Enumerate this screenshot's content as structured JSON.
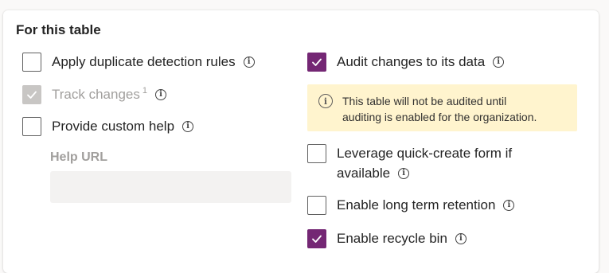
{
  "section": {
    "title": "For this table"
  },
  "left": {
    "duplicate_detection": {
      "label": "Apply duplicate detection rules",
      "checked": false
    },
    "track_changes": {
      "label": "Track changes",
      "superscript": "1",
      "checked": true,
      "disabled": true
    },
    "custom_help": {
      "label": "Provide custom help",
      "checked": false
    },
    "help_url": {
      "label": "Help URL",
      "value": ""
    }
  },
  "right": {
    "audit_changes": {
      "label": "Audit changes to its data",
      "checked": true
    },
    "audit_notice": {
      "text": "This table will not be audited until\nauditing is enabled for the organization."
    },
    "quick_create": {
      "label_line1": "Leverage quick-create form if",
      "label_line2": "available",
      "checked": false
    },
    "long_term_retention": {
      "label": "Enable long term retention",
      "checked": false
    },
    "recycle_bin": {
      "label": "Enable recycle bin",
      "checked": true
    }
  },
  "colors": {
    "checked_fill": "#742774",
    "disabled_fill": "#c8c6c4",
    "notice_bg": "#fff4ce"
  },
  "icons": {
    "info": "info-icon",
    "check": "checkmark-icon"
  }
}
